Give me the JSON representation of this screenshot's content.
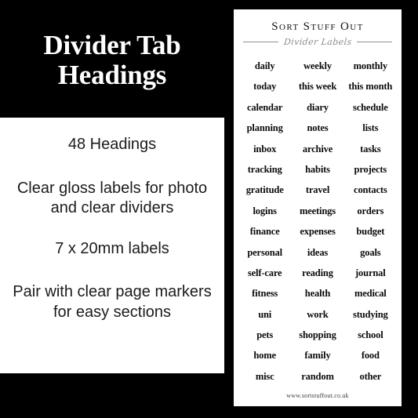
{
  "left_panel": {
    "title": "Divider Tab Headings",
    "lines": [
      "48 Headings",
      "Clear gloss labels for photo and clear dividers",
      "7 x 20mm labels",
      "Pair with clear page markers for easy sections"
    ]
  },
  "card": {
    "brand": "Sort Stuff Out",
    "subtitle": "Divider Labels",
    "footer_url": "www.sortstuffout.co.uk",
    "labels": [
      "daily",
      "weekly",
      "monthly",
      "today",
      "this week",
      "this month",
      "calendar",
      "diary",
      "schedule",
      "planning",
      "notes",
      "lists",
      "inbox",
      "archive",
      "tasks",
      "tracking",
      "habits",
      "projects",
      "gratitude",
      "travel",
      "contacts",
      "logins",
      "meetings",
      "orders",
      "finance",
      "expenses",
      "budget",
      "personal",
      "ideas",
      "goals",
      "self-care",
      "reading",
      "journal",
      "fitness",
      "health",
      "medical",
      "uni",
      "work",
      "studying",
      "pets",
      "shopping",
      "school",
      "home",
      "family",
      "food",
      "misc",
      "random",
      "other"
    ]
  },
  "colors": {
    "background": "#000000",
    "panel": "#ffffff",
    "text": "#0c0c0c",
    "muted": "#8a8a8a"
  }
}
